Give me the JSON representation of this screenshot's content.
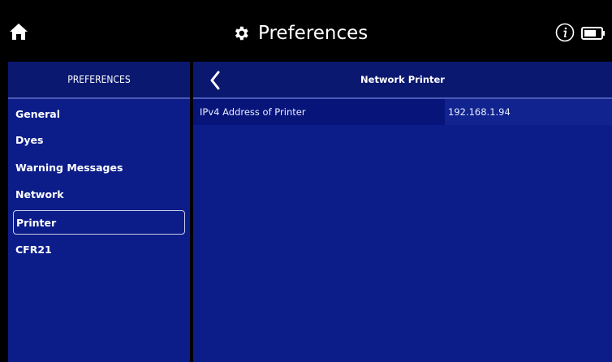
{
  "header": {
    "title": "Preferences",
    "home_icon": "home-icon",
    "settings_icon": "gear-icon",
    "info_icon": "info-icon",
    "battery_icon": "battery-icon"
  },
  "sidebar": {
    "heading": "PREFERENCES",
    "items": [
      {
        "label": "General",
        "active": false
      },
      {
        "label": "Dyes",
        "active": false
      },
      {
        "label": "Warning Messages",
        "active": false
      },
      {
        "label": "Network",
        "active": false
      },
      {
        "label": "Printer",
        "active": true
      },
      {
        "label": "CFR21",
        "active": false
      }
    ]
  },
  "main": {
    "title": "Network Printer",
    "back_icon": "chevron-left-icon",
    "rows": [
      {
        "label": "IPv4 Address of Printer",
        "value": "192.168.1.94"
      }
    ]
  },
  "colors": {
    "panel": "#0c1d8a",
    "panel_header": "#0a1870",
    "background": "#000000",
    "text": "#ffffff"
  }
}
